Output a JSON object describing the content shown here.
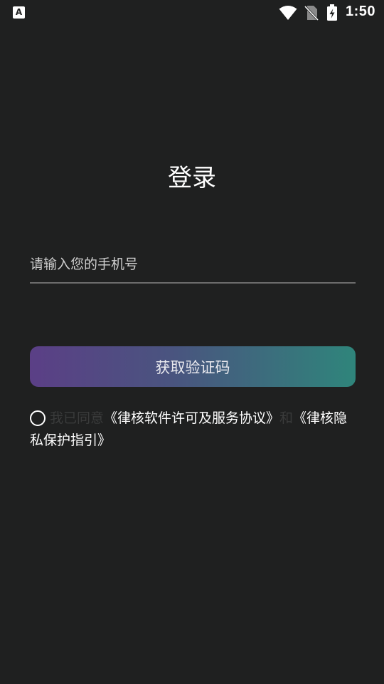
{
  "status_bar": {
    "left_icon_letter": "A",
    "time": "1:50",
    "icons": [
      "wifi-icon",
      "no-sim-icon",
      "battery-charging-icon"
    ]
  },
  "login": {
    "title": "登录",
    "phone_placeholder": "请输入您的手机号",
    "get_code_label": "获取验证码"
  },
  "agreement": {
    "prefix": "我已同意",
    "terms_link": "《律核软件许可及服务协议》",
    "conjunction": "和",
    "privacy_link": "《律核隐私保护指引》"
  },
  "colors": {
    "background": "#1f2020",
    "button_gradient_start": "#5b3f86",
    "button_gradient_end": "#2f857b",
    "muted_text": "#3a3b3b"
  }
}
